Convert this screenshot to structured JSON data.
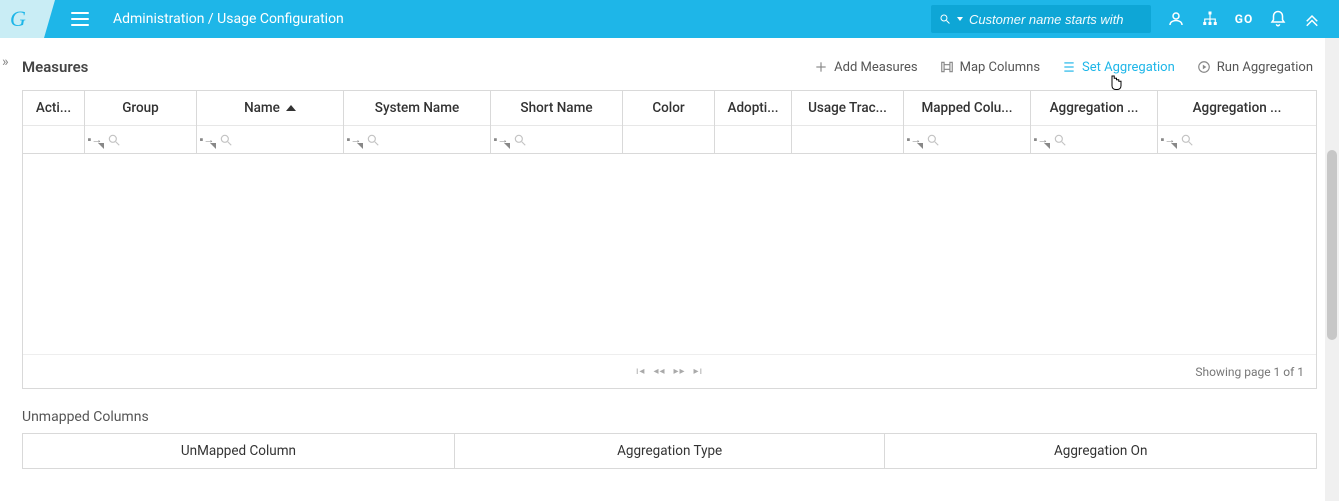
{
  "header": {
    "logo_letter": "G",
    "breadcrumb": "Administration / Usage Configuration",
    "search_placeholder": "Customer name starts with",
    "go_label": "GO"
  },
  "measures": {
    "title": "Measures",
    "actions": {
      "add": "Add Measures",
      "map": "Map Columns",
      "set": "Set Aggregation",
      "run": "Run Aggregation"
    },
    "columns": {
      "actions": "Acti...",
      "group": "Group",
      "name": "Name",
      "system_name": "System Name",
      "short_name": "Short Name",
      "color": "Color",
      "adoption": "Adopti...",
      "usage_tracking": "Usage Trac...",
      "mapped_column": "Mapped Colu...",
      "aggregation1": "Aggregation ...",
      "aggregation2": "Aggregation ..."
    },
    "page_info": "Showing page 1 of 1"
  },
  "unmapped": {
    "title": "Unmapped Columns",
    "columns": {
      "unmapped_column": "UnMapped Column",
      "aggregation_type": "Aggregation Type",
      "aggregation_on": "Aggregation On"
    }
  }
}
